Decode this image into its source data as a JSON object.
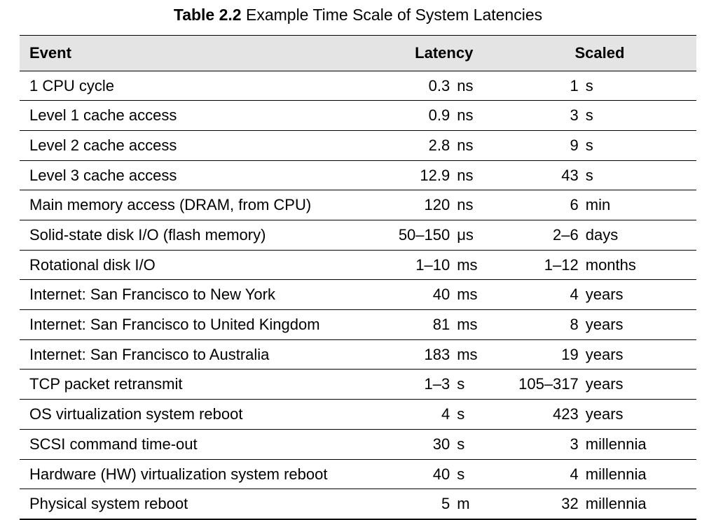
{
  "caption_prefix": "Table 2.2",
  "caption_title": "Example Time Scale of System Latencies",
  "headers": {
    "event": "Event",
    "latency": "Latency",
    "scaled": "Scaled"
  },
  "rows": [
    {
      "event": "1 CPU cycle",
      "lat_v": "0.3",
      "lat_u": "ns",
      "sc_v": "1",
      "sc_u": "s"
    },
    {
      "event": "Level 1 cache access",
      "lat_v": "0.9",
      "lat_u": "ns",
      "sc_v": "3",
      "sc_u": "s"
    },
    {
      "event": "Level 2 cache access",
      "lat_v": "2.8",
      "lat_u": "ns",
      "sc_v": "9",
      "sc_u": "s"
    },
    {
      "event": "Level 3 cache access",
      "lat_v": "12.9",
      "lat_u": "ns",
      "sc_v": "43",
      "sc_u": "s"
    },
    {
      "event": "Main memory access (DRAM, from CPU)",
      "lat_v": "120",
      "lat_u": "ns",
      "sc_v": "6",
      "sc_u": "min"
    },
    {
      "event": "Solid-state disk I/O (flash memory)",
      "lat_v": "50–150",
      "lat_u": "μs",
      "sc_v": "2–6",
      "sc_u": "days"
    },
    {
      "event": "Rotational disk I/O",
      "lat_v": "1–10",
      "lat_u": "ms",
      "sc_v": "1–12",
      "sc_u": "months"
    },
    {
      "event": "Internet: San Francisco to New York",
      "lat_v": "40",
      "lat_u": "ms",
      "sc_v": "4",
      "sc_u": "years"
    },
    {
      "event": "Internet: San Francisco to United Kingdom",
      "lat_v": "81",
      "lat_u": "ms",
      "sc_v": "8",
      "sc_u": "years"
    },
    {
      "event": "Internet: San Francisco to Australia",
      "lat_v": "183",
      "lat_u": "ms",
      "sc_v": "19",
      "sc_u": "years"
    },
    {
      "event": "TCP packet retransmit",
      "lat_v": "1–3",
      "lat_u": "s",
      "sc_v": "105–317",
      "sc_u": "years"
    },
    {
      "event": "OS virtualization system reboot",
      "lat_v": "4",
      "lat_u": "s",
      "sc_v": "423",
      "sc_u": "years"
    },
    {
      "event": "SCSI command time-out",
      "lat_v": "30",
      "lat_u": "s",
      "sc_v": "3",
      "sc_u": "millennia"
    },
    {
      "event": "Hardware (HW) virtualization system reboot",
      "lat_v": "40",
      "lat_u": "s",
      "sc_v": "4",
      "sc_u": "millennia"
    },
    {
      "event": "Physical system reboot",
      "lat_v": "5",
      "lat_u": "m",
      "sc_v": "32",
      "sc_u": "millennia"
    }
  ],
  "chart_data": {
    "type": "table",
    "title": "Table 2.2 Example Time Scale of System Latencies",
    "columns": [
      "Event",
      "Latency",
      "Scaled"
    ],
    "rows": [
      [
        "1 CPU cycle",
        "0.3 ns",
        "1 s"
      ],
      [
        "Level 1 cache access",
        "0.9 ns",
        "3 s"
      ],
      [
        "Level 2 cache access",
        "2.8 ns",
        "9 s"
      ],
      [
        "Level 3 cache access",
        "12.9 ns",
        "43 s"
      ],
      [
        "Main memory access (DRAM, from CPU)",
        "120 ns",
        "6 min"
      ],
      [
        "Solid-state disk I/O (flash memory)",
        "50–150 μs",
        "2–6 days"
      ],
      [
        "Rotational disk I/O",
        "1–10 ms",
        "1–12 months"
      ],
      [
        "Internet: San Francisco to New York",
        "40 ms",
        "4 years"
      ],
      [
        "Internet: San Francisco to United Kingdom",
        "81 ms",
        "8 years"
      ],
      [
        "Internet: San Francisco to Australia",
        "183 ms",
        "19 years"
      ],
      [
        "TCP packet retransmit",
        "1–3 s",
        "105–317 years"
      ],
      [
        "OS virtualization system reboot",
        "4 s",
        "423 years"
      ],
      [
        "SCSI command time-out",
        "30 s",
        "3 millennia"
      ],
      [
        "Hardware (HW) virtualization system reboot",
        "40 s",
        "4 millennia"
      ],
      [
        "Physical system reboot",
        "5 m",
        "32 millennia"
      ]
    ]
  }
}
